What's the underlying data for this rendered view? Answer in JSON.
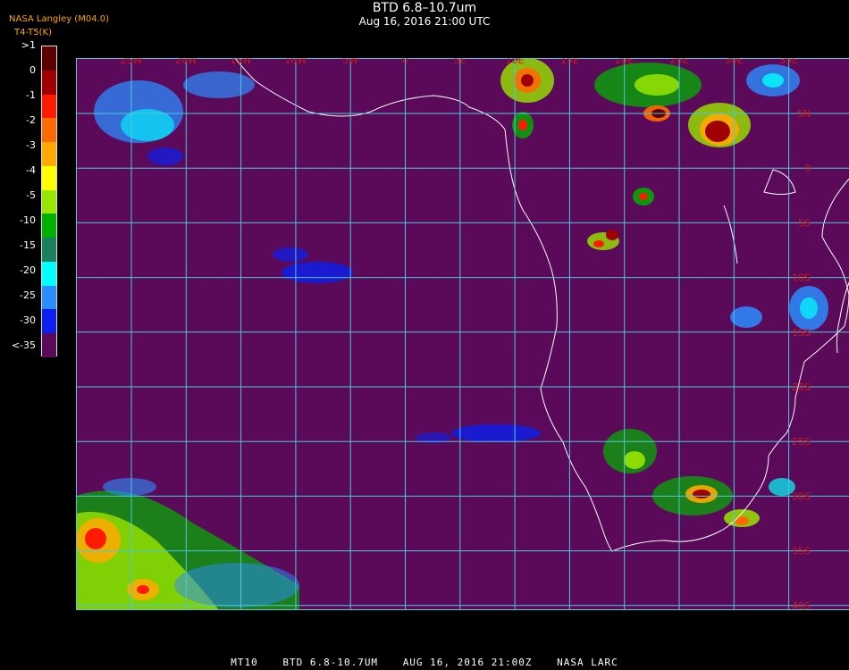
{
  "header": {
    "title": "BTD 6.8–10.7um",
    "subtitle": "Aug 16, 2016 21:00 UTC",
    "credit": "NASA Langley (M04.0)",
    "units": "T4-T5(K)"
  },
  "legend": {
    "labels": [
      ">1",
      "0",
      "-1",
      "-2",
      "-3",
      "-4",
      "-5",
      "-10",
      "-15",
      "-20",
      "-25",
      "-30",
      "<-35"
    ],
    "colors": [
      "#5b0000",
      "#a00000",
      "#ff1a00",
      "#ff6a00",
      "#ffaa00",
      "#ffff00",
      "#99e600",
      "#00b000",
      "#1a8060",
      "#00ffff",
      "#2b8cff",
      "#0a1ff0",
      "#5a0a58"
    ]
  },
  "map": {
    "lon_labels": [
      "25W",
      "20W",
      "15W",
      "10W",
      "5W",
      "0",
      "5E",
      "10E",
      "15E",
      "20E",
      "25E",
      "30E",
      "35E"
    ],
    "lat_labels": [
      "5N",
      "0",
      "5S",
      "10S",
      "15S",
      "20S",
      "25S",
      "30S",
      "35S",
      "40S"
    ],
    "colors": {
      "background": "#5a0a58",
      "grid": "#4cc9dd",
      "coast": "#ffffff",
      "label": "#d01818"
    }
  },
  "footer": {
    "satellite": "MT10",
    "product": "BTD 6.8-10.7UM",
    "datetime": "AUG 16, 2016 21:00Z",
    "source": "NASA LARC"
  }
}
